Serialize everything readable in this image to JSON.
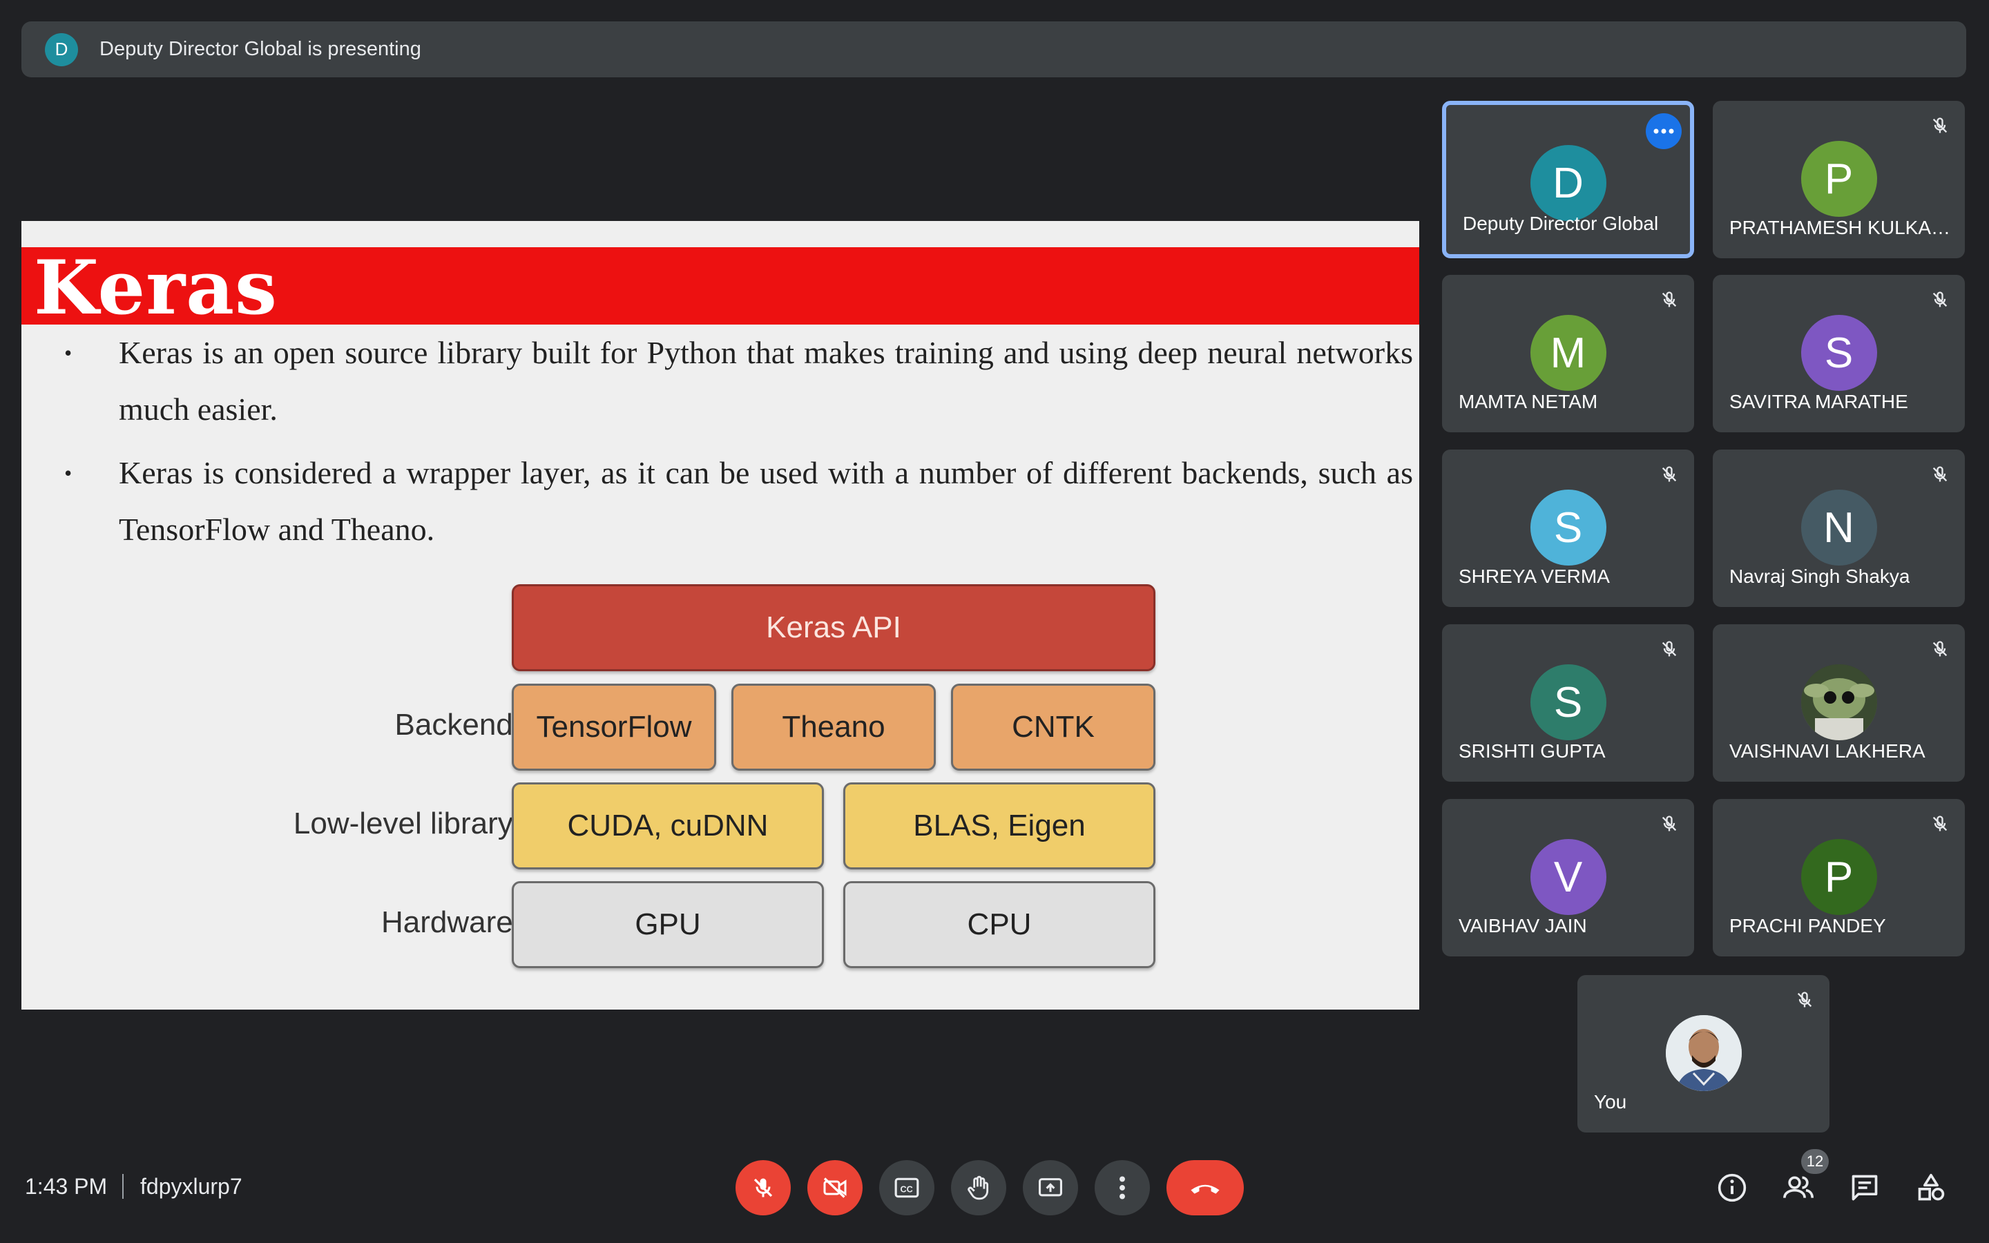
{
  "banner": {
    "avatar_letter": "D",
    "text": "Deputy Director Global is presenting"
  },
  "slide": {
    "title": "Keras",
    "bullets": [
      "Keras is an open source library built for Python that makes training and using deep neural networks much easier.",
      "Keras is considered a wrapper layer, as it can be used with a number of different backends, such as TensorFlow and Theano."
    ],
    "bullet_marker": "•",
    "diagram": {
      "api": "Keras API",
      "backend_label": "Backend:",
      "backends": [
        "TensorFlow",
        "Theano",
        "CNTK"
      ],
      "lowlevel_label": "Low-level library:",
      "lowlevel": [
        "CUDA, cuDNN",
        "BLAS, Eigen"
      ],
      "hardware_label": "Hardware:",
      "hardware": [
        "GPU",
        "CPU"
      ]
    }
  },
  "participants": [
    {
      "letter": "D",
      "name": "Deputy Director Global",
      "color": "#1e8e9e",
      "active": true
    },
    {
      "letter": "P",
      "name": "PRATHAMESH KULKAR...",
      "color": "#689f38"
    },
    {
      "letter": "M",
      "name": "MAMTA NETAM",
      "color": "#689f38"
    },
    {
      "letter": "S",
      "name": "SAVITRA MARATHE",
      "color": "#7e57c2"
    },
    {
      "letter": "S",
      "name": "SHREYA VERMA",
      "color": "#4fb3d9"
    },
    {
      "letter": "N",
      "name": "Navraj Singh Shakya",
      "color": "#455a64"
    },
    {
      "letter": "S",
      "name": "SRISHTI GUPTA",
      "color": "#2e7d6b"
    },
    {
      "letter": "",
      "name": "VAISHNAVI LAKHERA",
      "color": "#4a5a3a"
    },
    {
      "letter": "V",
      "name": "VAIBHAV JAIN",
      "color": "#7e57c2"
    },
    {
      "letter": "P",
      "name": "PRACHI PANDEY",
      "color": "#33691e"
    },
    {
      "letter": "",
      "name": "You",
      "color": "#cfd8dc"
    }
  ],
  "bottom": {
    "time": "1:43 PM",
    "meeting_code": "fdpyxlurp7",
    "people_count": "12"
  },
  "colors": {
    "accent": "#8ab4f8",
    "danger": "#ea4335",
    "tile": "#3c4043",
    "bg": "#202124"
  }
}
